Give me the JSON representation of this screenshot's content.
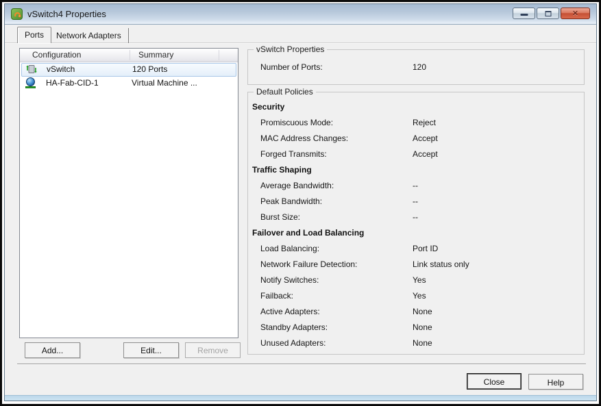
{
  "window": {
    "title": "vSwitch4 Properties",
    "controls": {
      "minimize_icon": "minimize",
      "maximize_icon": "maximize",
      "close_icon": "close",
      "close_glyph": "✕"
    },
    "titlebar_icon": "vmware-vsphere-icon"
  },
  "tabs": {
    "ports": "Ports",
    "network_adapters": "Network Adapters"
  },
  "list": {
    "columns": {
      "configuration": "Configuration",
      "summary": "Summary"
    },
    "rows": [
      {
        "icon": "vswitch-icon",
        "config": "vSwitch",
        "summary": "120 Ports",
        "selected": true
      },
      {
        "icon": "vm-network-icon",
        "config": "HA-Fab-CID-1",
        "summary": "Virtual Machine ...",
        "selected": false
      }
    ]
  },
  "left_buttons": {
    "add": "Add...",
    "edit": "Edit...",
    "remove": "Remove",
    "remove_disabled": true
  },
  "vswitch_properties": {
    "title": "vSwitch Properties",
    "number_of_ports_label": "Number of Ports:",
    "number_of_ports_value": "120"
  },
  "policies": {
    "title": "Default Policies",
    "sections": [
      {
        "heading": "Security",
        "rows": [
          {
            "label": "Promiscuous Mode:",
            "value": "Reject"
          },
          {
            "label": "MAC Address Changes:",
            "value": "Accept"
          },
          {
            "label": "Forged Transmits:",
            "value": "Accept"
          }
        ]
      },
      {
        "heading": "Traffic Shaping",
        "rows": [
          {
            "label": "Average Bandwidth:",
            "value": "--"
          },
          {
            "label": "Peak Bandwidth:",
            "value": "--"
          },
          {
            "label": "Burst Size:",
            "value": "--"
          }
        ]
      },
      {
        "heading": "Failover and Load Balancing",
        "rows": [
          {
            "label": "Load Balancing:",
            "value": "Port ID"
          },
          {
            "label": "Network Failure Detection:",
            "value": "Link status only"
          },
          {
            "label": "Notify Switches:",
            "value": "Yes"
          },
          {
            "label": "Failback:",
            "value": "Yes"
          },
          {
            "label": "Active Adapters:",
            "value": "None"
          },
          {
            "label": "Standby Adapters:",
            "value": "None"
          },
          {
            "label": "Unused Adapters:",
            "value": "None"
          }
        ]
      }
    ]
  },
  "footer": {
    "close": "Close",
    "help": "Help"
  },
  "colors": {
    "titlebar": "#b7c8db",
    "window_bg": "#f0f0f0",
    "selection_fill": "#e4effa",
    "selection_border": "#a8c7e8",
    "close_button_red": "#c44f34",
    "disabled_text": "#a3a3a3"
  }
}
